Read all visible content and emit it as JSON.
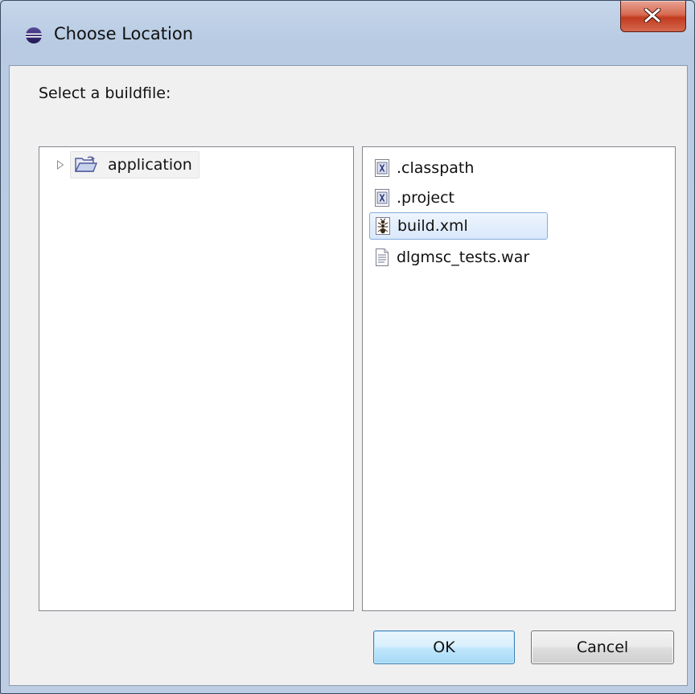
{
  "window": {
    "title": "Choose Location",
    "close_glyph": "x"
  },
  "prompt": "Select a buildfile:",
  "tree": {
    "items": [
      {
        "label": "application",
        "icon": "folder-open-icon",
        "expanded": false
      }
    ]
  },
  "files": [
    {
      "label": ".classpath",
      "icon": "xml-file-icon",
      "selected": false
    },
    {
      "label": ".project",
      "icon": "xml-file-icon",
      "selected": false
    },
    {
      "label": "build.xml",
      "icon": "ant-file-icon",
      "selected": true
    },
    {
      "label": "dlgmsc_tests.war",
      "icon": "text-file-icon",
      "selected": false
    }
  ],
  "buttons": {
    "ok": "OK",
    "cancel": "Cancel"
  },
  "colors": {
    "selection_border": "#84acdd",
    "selection_fill": "#d9e8fb",
    "close_button": "#c23b1f"
  }
}
